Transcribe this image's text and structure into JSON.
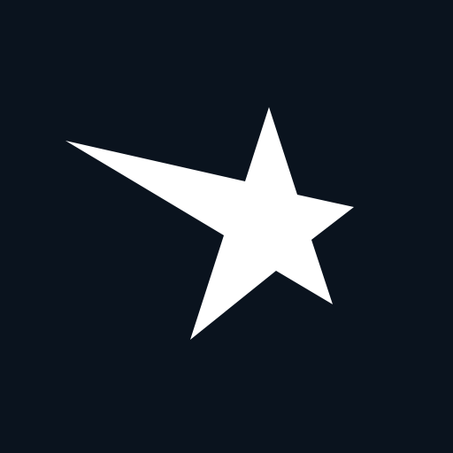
{
  "logo": {
    "icon": "shooting-star-icon",
    "colors": {
      "background": "#0a131e",
      "foreground": "#ffffff"
    }
  }
}
